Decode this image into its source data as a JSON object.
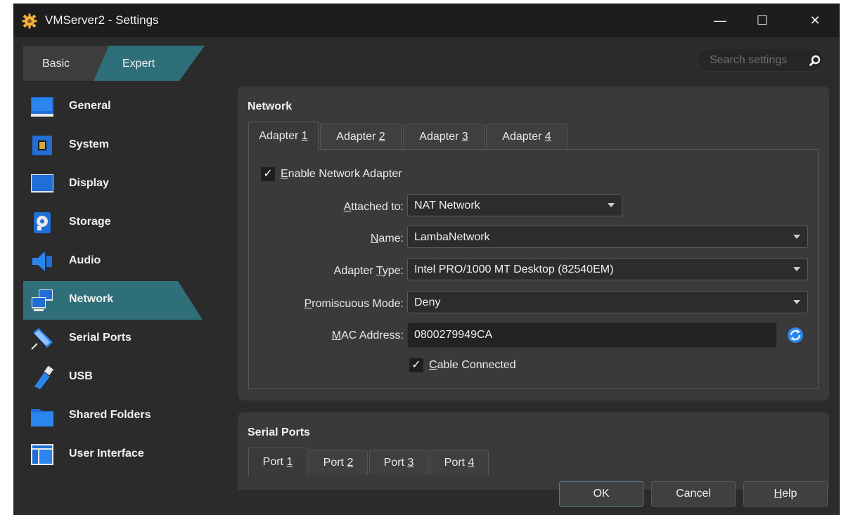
{
  "window": {
    "title": "VMServer2 - Settings",
    "controls": {
      "minimize": "—",
      "maximize": "☐",
      "close": "✕"
    }
  },
  "mode": {
    "basic": "Basic",
    "expert": "Expert",
    "selected": "Expert"
  },
  "search": {
    "placeholder": "Search settings",
    "value": ""
  },
  "sidebar": {
    "items": [
      {
        "label": "General",
        "icon": "general-icon"
      },
      {
        "label": "System",
        "icon": "system-icon"
      },
      {
        "label": "Display",
        "icon": "display-icon"
      },
      {
        "label": "Storage",
        "icon": "storage-icon"
      },
      {
        "label": "Audio",
        "icon": "audio-icon"
      },
      {
        "label": "Network",
        "icon": "network-icon",
        "selected": true
      },
      {
        "label": "Serial Ports",
        "icon": "serial-ports-icon"
      },
      {
        "label": "USB",
        "icon": "usb-icon"
      },
      {
        "label": "Shared Folders",
        "icon": "shared-folders-icon"
      },
      {
        "label": "User Interface",
        "icon": "user-interface-icon"
      }
    ]
  },
  "network": {
    "title": "Network",
    "tabs": [
      {
        "pre": "Adapter ",
        "key": "1"
      },
      {
        "pre": "Adapter ",
        "key": "2"
      },
      {
        "pre": "Adapter ",
        "key": "3"
      },
      {
        "pre": "Adapter ",
        "key": "4"
      }
    ],
    "enable": {
      "key": "E",
      "rest": "nable Network Adapter",
      "checked": true
    },
    "attached_to": {
      "key": "A",
      "rest": "ttached to:",
      "value": "NAT Network"
    },
    "name": {
      "key": "N",
      "rest": "ame:",
      "value": "LambaNetwork"
    },
    "adapter_type": {
      "pre": "Adapter ",
      "key": "T",
      "rest": "ype:",
      "value": "Intel PRO/1000 MT Desktop (82540EM)"
    },
    "promiscuous": {
      "key": "P",
      "rest": "romiscuous Mode:",
      "value": "Deny"
    },
    "mac": {
      "key": "M",
      "rest": "AC Address:",
      "value": "0800279949CA"
    },
    "cable": {
      "key": "C",
      "rest": "able Connected",
      "checked": true
    },
    "check_glyph": "✓"
  },
  "serial": {
    "title": "Serial Ports",
    "tabs": [
      {
        "pre": "Port ",
        "key": "1"
      },
      {
        "pre": "Port ",
        "key": "2"
      },
      {
        "pre": "Port ",
        "key": "3"
      },
      {
        "pre": "Port ",
        "key": "4"
      }
    ]
  },
  "buttons": {
    "ok": "OK",
    "cancel": "Cancel",
    "help_key": "H",
    "help_rest": "elp"
  },
  "colors": {
    "accent": "#2f6f79",
    "panel": "#3a3a3b",
    "window": "#2b2b2c",
    "titlebar": "#1d1d1d"
  }
}
